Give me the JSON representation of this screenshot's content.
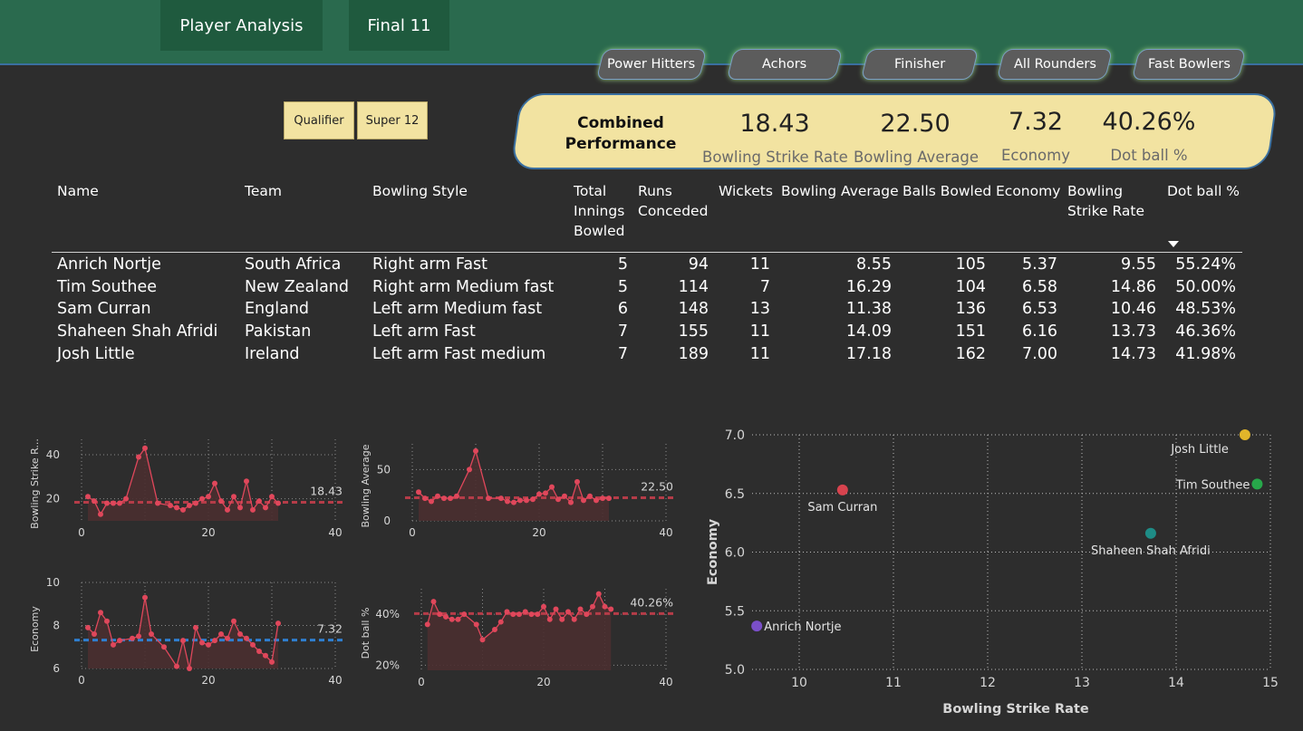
{
  "nav": {
    "player_analysis": "Player Analysis",
    "final_11": "Final 11"
  },
  "roles": {
    "power_hitters": "Power Hitters",
    "anchors": "Achors",
    "finisher": "Finisher",
    "all_rounders": "All Rounders",
    "fast_bowlers": "Fast Bowlers"
  },
  "stages": {
    "qualifier": "Qualifier",
    "super12": "Super 12"
  },
  "kpi": {
    "title_line1": "Combined",
    "title_line2": "Performance",
    "strike_rate": "18.43",
    "strike_rate_label": "Bowling Strike Rate",
    "average": "22.50",
    "average_label": "Bowling Average",
    "economy": "7.32",
    "economy_label": "Economy",
    "dot_ball": "40.26%",
    "dot_ball_label": "Dot ball %"
  },
  "table": {
    "headers": {
      "name": "Name",
      "team": "Team",
      "style": "Bowling Style",
      "innings_1": "Total",
      "innings_2": "Innings",
      "innings_3": "Bowled",
      "runs_1": "Runs",
      "runs_2": "Conceded",
      "wickets": "Wickets",
      "avg": "Bowling Average",
      "balls": "Balls Bowled",
      "econ": "Economy",
      "sr_1": "Bowling",
      "sr_2": "Strike Rate",
      "dot": "Dot ball %"
    },
    "rows": [
      {
        "name": "Anrich Nortje",
        "team": "South Africa",
        "style": "Right arm Fast",
        "innings": "5",
        "runs": "94",
        "wickets": "11",
        "avg": "8.55",
        "balls": "105",
        "econ": "5.37",
        "sr": "9.55",
        "dot": "55.24%"
      },
      {
        "name": "Tim Southee",
        "team": "New Zealand",
        "style": "Right arm Medium fast",
        "innings": "5",
        "runs": "114",
        "wickets": "7",
        "avg": "16.29",
        "balls": "104",
        "econ": "6.58",
        "sr": "14.86",
        "dot": "50.00%"
      },
      {
        "name": "Sam Curran",
        "team": "England",
        "style": "Left arm Medium fast",
        "innings": "6",
        "runs": "148",
        "wickets": "13",
        "avg": "11.38",
        "balls": "136",
        "econ": "6.53",
        "sr": "10.46",
        "dot": "48.53%"
      },
      {
        "name": "Shaheen Shah Afridi",
        "team": "Pakistan",
        "style": "Left arm Fast",
        "innings": "7",
        "runs": "155",
        "wickets": "11",
        "avg": "14.09",
        "balls": "151",
        "econ": "6.16",
        "sr": "13.73",
        "dot": "46.36%"
      },
      {
        "name": "Josh Little",
        "team": "Ireland",
        "style": "Left arm Fast medium",
        "innings": "7",
        "runs": "189",
        "wickets": "11",
        "avg": "17.18",
        "balls": "162",
        "econ": "7.00",
        "sr": "14.73",
        "dot": "41.98%"
      }
    ]
  },
  "colors": {
    "line": "#e0475b",
    "area": "#4a2f30",
    "ref_red": "#b53c48",
    "ref_blue": "#2f7fd0"
  },
  "chart_data": [
    {
      "type": "line",
      "ylabel": "Bowling Strike R...",
      "xlim": [
        0,
        40
      ],
      "ylim": [
        10,
        47
      ],
      "xticks": [
        "0",
        "20",
        "40"
      ],
      "yticks": [
        "20",
        "40"
      ],
      "ytick_values": [
        20,
        40
      ],
      "reference": {
        "value": 18.43,
        "label": "18.43",
        "color": "ref_red"
      },
      "x": [
        1,
        2,
        3,
        4,
        5,
        6,
        7,
        9,
        10,
        12,
        14,
        15,
        16,
        17,
        18,
        19,
        20,
        21,
        22,
        23,
        24,
        25,
        26,
        27,
        28,
        29,
        30,
        31
      ],
      "values": [
        21,
        19,
        13,
        18,
        18,
        18,
        20,
        39,
        43,
        18,
        17,
        16,
        15,
        17,
        18,
        20,
        21,
        27,
        19,
        15,
        21,
        16,
        28,
        15,
        19,
        16,
        21,
        18
      ]
    },
    {
      "type": "line",
      "ylabel": "Bowling Average",
      "xlim": [
        0,
        40
      ],
      "ylim": [
        0,
        75
      ],
      "xticks": [
        "0",
        "20",
        "40"
      ],
      "yticks": [
        "0",
        "50"
      ],
      "ytick_values": [
        0,
        50
      ],
      "reference": {
        "value": 22.5,
        "label": "22.50",
        "color": "ref_red"
      },
      "x": [
        1,
        2,
        3,
        4,
        5,
        6,
        7,
        9,
        10,
        12,
        14,
        15,
        16,
        17,
        18,
        19,
        20,
        21,
        22,
        23,
        24,
        25,
        26,
        27,
        28,
        29,
        30,
        31
      ],
      "values": [
        28,
        22,
        19,
        24,
        22,
        22,
        24,
        50,
        68,
        22,
        22,
        19,
        18,
        20,
        20,
        21,
        26,
        27,
        33,
        21,
        24,
        18,
        38,
        20,
        24,
        20,
        22,
        22
      ]
    },
    {
      "type": "line",
      "ylabel": "Economy",
      "xlim": [
        0,
        40
      ],
      "ylim": [
        6,
        10
      ],
      "xticks": [
        "0",
        "20",
        "40"
      ],
      "yticks": [
        "6",
        "8",
        "10"
      ],
      "ytick_values": [
        6,
        8,
        10
      ],
      "reference": {
        "value": 7.32,
        "label": "7.32",
        "color": "ref_blue"
      },
      "x": [
        1,
        2,
        3,
        4,
        5,
        6,
        8,
        9,
        10,
        11,
        13,
        15,
        16,
        17,
        18,
        19,
        20,
        21,
        22,
        23,
        24,
        25,
        26,
        27,
        28,
        29,
        30,
        31
      ],
      "values": [
        7.9,
        7.6,
        8.6,
        8.2,
        7.1,
        7.3,
        7.4,
        7.5,
        9.3,
        7.6,
        7.0,
        6.1,
        7.3,
        6.0,
        7.9,
        7.2,
        7.1,
        7.3,
        7.6,
        7.4,
        8.2,
        7.6,
        7.4,
        7.1,
        6.8,
        6.6,
        6.3,
        8.1
      ]
    },
    {
      "type": "line",
      "ylabel": "Dot ball %",
      "xlim": [
        0,
        40
      ],
      "ylim": [
        18,
        50
      ],
      "xticks": [
        "0",
        "20",
        "40"
      ],
      "yticks": [
        "20%",
        "40%"
      ],
      "ytick_values": [
        20,
        40
      ],
      "reference": {
        "value": 40.26,
        "label": "40.26%",
        "color": "ref_red"
      },
      "x": [
        1,
        2,
        3,
        4,
        5,
        6,
        7,
        9,
        10,
        12,
        13,
        14,
        15,
        16,
        17,
        18,
        19,
        20,
        21,
        22,
        23,
        24,
        25,
        26,
        27,
        28,
        29,
        30,
        31
      ],
      "values": [
        36,
        45,
        40,
        39,
        38,
        38,
        40,
        36,
        30,
        34,
        37,
        41,
        40,
        40,
        41,
        40,
        40,
        43,
        38,
        42,
        38,
        41,
        38,
        42,
        40,
        43,
        48,
        43,
        42
      ]
    },
    {
      "type": "scatter",
      "xlabel": "Bowling Strike Rate",
      "ylabel": "Economy",
      "xlim": [
        9.5,
        15
      ],
      "ylim": [
        5.0,
        7.0
      ],
      "xticks": [
        "10",
        "11",
        "12",
        "13",
        "14",
        "15"
      ],
      "xtick_values": [
        10,
        11,
        12,
        13,
        14,
        15
      ],
      "yticks": [
        "5.0",
        "5.5",
        "6.0",
        "6.5",
        "7.0"
      ],
      "ytick_values": [
        5.0,
        5.5,
        6.0,
        6.5,
        7.0
      ],
      "points": [
        {
          "name": "Anrich Nortje",
          "x": 9.55,
          "y": 5.37,
          "color": "#7a4fc8"
        },
        {
          "name": "Tim Southee",
          "x": 14.86,
          "y": 6.58,
          "color": "#27a84a"
        },
        {
          "name": "Sam Curran",
          "x": 10.46,
          "y": 6.53,
          "color": "#d8434e"
        },
        {
          "name": "Shaheen Shah Afridi",
          "x": 13.73,
          "y": 6.16,
          "color": "#1e8c86"
        },
        {
          "name": "Josh Little",
          "x": 14.73,
          "y": 7.0,
          "color": "#e1b52a"
        }
      ]
    }
  ]
}
